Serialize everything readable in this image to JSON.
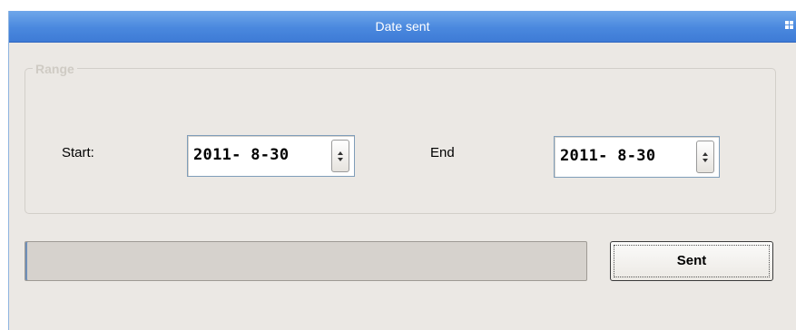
{
  "window": {
    "title": "Date sent"
  },
  "range": {
    "legend": "Range",
    "start_label": "Start:",
    "start_value": "2011- 8-30",
    "end_label": "End",
    "end_value": "2011- 8-30"
  },
  "progress": {
    "value": 0
  },
  "actions": {
    "sent_label": "Sent"
  },
  "icons": {
    "grip": "grip-icon",
    "spin_up": "spin-up-icon",
    "spin_down": "spin-down-icon"
  },
  "colors": {
    "titlebar": "#4a88de",
    "window_bg": "#ebe8e4"
  }
}
